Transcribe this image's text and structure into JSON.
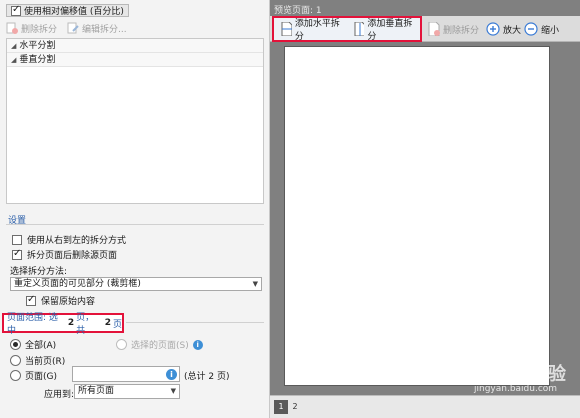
{
  "left": {
    "relative_offset_label": "使用相对偏移值 (百分比)",
    "toolbar": {
      "delete_split": "删除拆分",
      "edit_split": "编辑拆分..."
    },
    "tree": {
      "horizontal": "水平分割",
      "vertical": "垂直分割"
    },
    "settings": {
      "title": "设置",
      "rtl_label": "使用从右到左的拆分方式",
      "delete_source_label": "拆分页面后删除源页面",
      "method_label": "选择拆分方法:",
      "method_value": "重定义页面的可见部分 (裁剪框)",
      "keep_original_label": "保留原始内容"
    },
    "page_range": {
      "prefix": "页面范围: 选中",
      "selected_count": "2",
      "middle": "页，共",
      "total_count": "2",
      "suffix": "页"
    },
    "range_options": {
      "all": "全部(A)",
      "selected_pages": "选择的页面(S)",
      "current": "当前页(R)",
      "pages": "页面(G)",
      "total_note": "(总计 2 页)",
      "apply_label": "应用到:",
      "apply_value": "所有页面"
    }
  },
  "right": {
    "preview_label": "预览页面: 1",
    "add_horizontal": "添加水平拆分",
    "add_vertical": "添加垂直拆分",
    "delete_split": "删除拆分",
    "zoom_in": "放大",
    "zoom_out": "缩小",
    "page_tabs": [
      "1",
      "2"
    ]
  },
  "watermark": {
    "brand": "Baidu 经验",
    "url": "jingyan.baidu.com"
  }
}
